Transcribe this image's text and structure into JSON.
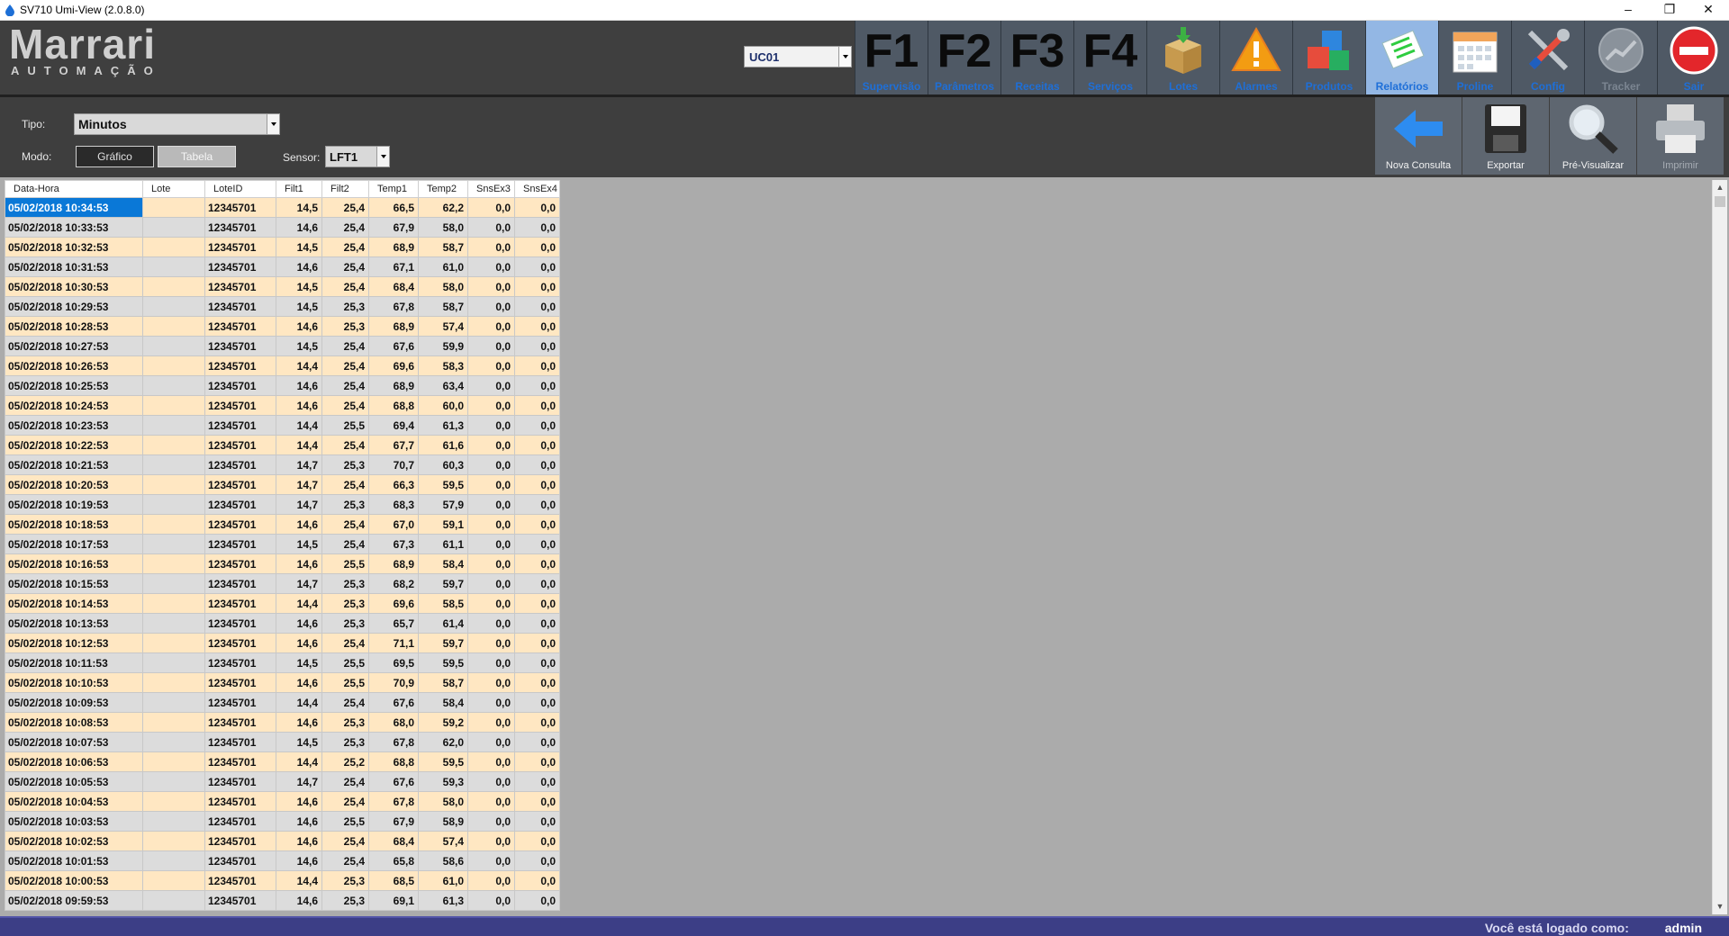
{
  "window": {
    "title": "SV710 Umi-View (2.0.8.0)",
    "minimize": "–",
    "maximize": "❐",
    "close": "✕"
  },
  "brand": {
    "name": "Marrari",
    "tagline": "AUTOMAÇÃO"
  },
  "unit_select": {
    "value": "UC01"
  },
  "nav": [
    {
      "key": "F1",
      "label": "Supervisão"
    },
    {
      "key": "F2",
      "label": "Parâmetros"
    },
    {
      "key": "F3",
      "label": "Receitas"
    },
    {
      "key": "F4",
      "label": "Serviços"
    },
    {
      "icon": "box-icon",
      "label": "Lotes"
    },
    {
      "icon": "warning-icon",
      "label": "Alarmes"
    },
    {
      "icon": "cubes-icon",
      "label": "Produtos"
    },
    {
      "icon": "report-icon",
      "label": "Relatórios",
      "active": true
    },
    {
      "icon": "calendar-icon",
      "label": "Proline"
    },
    {
      "icon": "tools-icon",
      "label": "Config"
    },
    {
      "icon": "trend-icon",
      "label": "Tracker",
      "disabled": true
    },
    {
      "icon": "exit-icon",
      "label": "Sair"
    }
  ],
  "filters": {
    "tipo_label": "Tipo:",
    "tipo_value": "Minutos",
    "modo_label": "Modo:",
    "mode_grafico": "Gráfico",
    "mode_tabela": "Tabela",
    "sensor_label": "Sensor:",
    "sensor_value": "LFT1"
  },
  "actions": [
    {
      "icon": "back-arrow-icon",
      "label": "Nova Consulta"
    },
    {
      "icon": "floppy-icon",
      "label": "Exportar"
    },
    {
      "icon": "magnifier-icon",
      "label": "Pré-Visualizar"
    },
    {
      "icon": "printer-icon",
      "label": "Imprimir",
      "disabled": true
    }
  ],
  "table": {
    "columns": [
      "Data-Hora",
      "Lote",
      "LoteID",
      "Filt1",
      "Filt2",
      "Temp1",
      "Temp2",
      "SnsEx3",
      "SnsEx4"
    ],
    "rows": [
      [
        "05/02/2018 10:34:53",
        "",
        "12345701",
        "14,5",
        "25,4",
        "66,5",
        "62,2",
        "0,0",
        "0,0"
      ],
      [
        "05/02/2018 10:33:53",
        "",
        "12345701",
        "14,6",
        "25,4",
        "67,9",
        "58,0",
        "0,0",
        "0,0"
      ],
      [
        "05/02/2018 10:32:53",
        "",
        "12345701",
        "14,5",
        "25,4",
        "68,9",
        "58,7",
        "0,0",
        "0,0"
      ],
      [
        "05/02/2018 10:31:53",
        "",
        "12345701",
        "14,6",
        "25,4",
        "67,1",
        "61,0",
        "0,0",
        "0,0"
      ],
      [
        "05/02/2018 10:30:53",
        "",
        "12345701",
        "14,5",
        "25,4",
        "68,4",
        "58,0",
        "0,0",
        "0,0"
      ],
      [
        "05/02/2018 10:29:53",
        "",
        "12345701",
        "14,5",
        "25,3",
        "67,8",
        "58,7",
        "0,0",
        "0,0"
      ],
      [
        "05/02/2018 10:28:53",
        "",
        "12345701",
        "14,6",
        "25,3",
        "68,9",
        "57,4",
        "0,0",
        "0,0"
      ],
      [
        "05/02/2018 10:27:53",
        "",
        "12345701",
        "14,5",
        "25,4",
        "67,6",
        "59,9",
        "0,0",
        "0,0"
      ],
      [
        "05/02/2018 10:26:53",
        "",
        "12345701",
        "14,4",
        "25,4",
        "69,6",
        "58,3",
        "0,0",
        "0,0"
      ],
      [
        "05/02/2018 10:25:53",
        "",
        "12345701",
        "14,6",
        "25,4",
        "68,9",
        "63,4",
        "0,0",
        "0,0"
      ],
      [
        "05/02/2018 10:24:53",
        "",
        "12345701",
        "14,6",
        "25,4",
        "68,8",
        "60,0",
        "0,0",
        "0,0"
      ],
      [
        "05/02/2018 10:23:53",
        "",
        "12345701",
        "14,4",
        "25,5",
        "69,4",
        "61,3",
        "0,0",
        "0,0"
      ],
      [
        "05/02/2018 10:22:53",
        "",
        "12345701",
        "14,4",
        "25,4",
        "67,7",
        "61,6",
        "0,0",
        "0,0"
      ],
      [
        "05/02/2018 10:21:53",
        "",
        "12345701",
        "14,7",
        "25,3",
        "70,7",
        "60,3",
        "0,0",
        "0,0"
      ],
      [
        "05/02/2018 10:20:53",
        "",
        "12345701",
        "14,7",
        "25,4",
        "66,3",
        "59,5",
        "0,0",
        "0,0"
      ],
      [
        "05/02/2018 10:19:53",
        "",
        "12345701",
        "14,7",
        "25,3",
        "68,3",
        "57,9",
        "0,0",
        "0,0"
      ],
      [
        "05/02/2018 10:18:53",
        "",
        "12345701",
        "14,6",
        "25,4",
        "67,0",
        "59,1",
        "0,0",
        "0,0"
      ],
      [
        "05/02/2018 10:17:53",
        "",
        "12345701",
        "14,5",
        "25,4",
        "67,3",
        "61,1",
        "0,0",
        "0,0"
      ],
      [
        "05/02/2018 10:16:53",
        "",
        "12345701",
        "14,6",
        "25,5",
        "68,9",
        "58,4",
        "0,0",
        "0,0"
      ],
      [
        "05/02/2018 10:15:53",
        "",
        "12345701",
        "14,7",
        "25,3",
        "68,2",
        "59,7",
        "0,0",
        "0,0"
      ],
      [
        "05/02/2018 10:14:53",
        "",
        "12345701",
        "14,4",
        "25,3",
        "69,6",
        "58,5",
        "0,0",
        "0,0"
      ],
      [
        "05/02/2018 10:13:53",
        "",
        "12345701",
        "14,6",
        "25,3",
        "65,7",
        "61,4",
        "0,0",
        "0,0"
      ],
      [
        "05/02/2018 10:12:53",
        "",
        "12345701",
        "14,6",
        "25,4",
        "71,1",
        "59,7",
        "0,0",
        "0,0"
      ],
      [
        "05/02/2018 10:11:53",
        "",
        "12345701",
        "14,5",
        "25,5",
        "69,5",
        "59,5",
        "0,0",
        "0,0"
      ],
      [
        "05/02/2018 10:10:53",
        "",
        "12345701",
        "14,6",
        "25,5",
        "70,9",
        "58,7",
        "0,0",
        "0,0"
      ],
      [
        "05/02/2018 10:09:53",
        "",
        "12345701",
        "14,4",
        "25,4",
        "67,6",
        "58,4",
        "0,0",
        "0,0"
      ],
      [
        "05/02/2018 10:08:53",
        "",
        "12345701",
        "14,6",
        "25,3",
        "68,0",
        "59,2",
        "0,0",
        "0,0"
      ],
      [
        "05/02/2018 10:07:53",
        "",
        "12345701",
        "14,5",
        "25,3",
        "67,8",
        "62,0",
        "0,0",
        "0,0"
      ],
      [
        "05/02/2018 10:06:53",
        "",
        "12345701",
        "14,4",
        "25,2",
        "68,8",
        "59,5",
        "0,0",
        "0,0"
      ],
      [
        "05/02/2018 10:05:53",
        "",
        "12345701",
        "14,7",
        "25,4",
        "67,6",
        "59,3",
        "0,0",
        "0,0"
      ],
      [
        "05/02/2018 10:04:53",
        "",
        "12345701",
        "14,6",
        "25,4",
        "67,8",
        "58,0",
        "0,0",
        "0,0"
      ],
      [
        "05/02/2018 10:03:53",
        "",
        "12345701",
        "14,6",
        "25,5",
        "67,9",
        "58,9",
        "0,0",
        "0,0"
      ],
      [
        "05/02/2018 10:02:53",
        "",
        "12345701",
        "14,6",
        "25,4",
        "68,4",
        "57,4",
        "0,0",
        "0,0"
      ],
      [
        "05/02/2018 10:01:53",
        "",
        "12345701",
        "14,6",
        "25,4",
        "65,8",
        "58,6",
        "0,0",
        "0,0"
      ],
      [
        "05/02/2018 10:00:53",
        "",
        "12345701",
        "14,4",
        "25,3",
        "68,5",
        "61,0",
        "0,0",
        "0,0"
      ],
      [
        "05/02/2018 09:59:53",
        "",
        "12345701",
        "14,6",
        "25,3",
        "69,1",
        "61,3",
        "0,0",
        "0,0"
      ]
    ]
  },
  "status": {
    "login_text": "Você está logado como:",
    "user": "admin"
  },
  "colors": {
    "header_bg": "#3f3f3f",
    "nav_active": "#93b7e4",
    "nav_label": "#1e6fd8",
    "row_odd": "#ffe7c2",
    "row_even": "#dcdcdc",
    "selection": "#0a78d7",
    "statusbar": "#3c3e86"
  }
}
